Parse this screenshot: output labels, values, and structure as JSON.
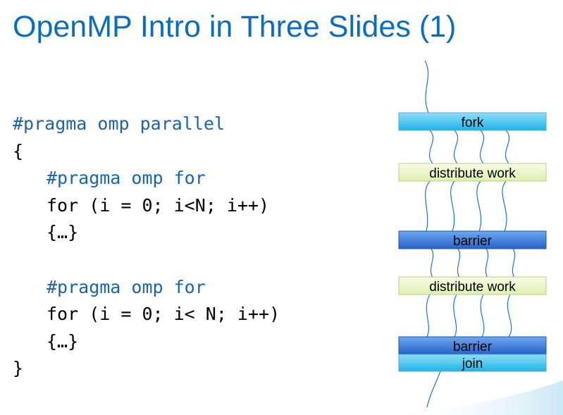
{
  "slide": {
    "title": "OpenMP Intro in Three Slides (1)"
  },
  "code": {
    "line1": "#pragma omp parallel",
    "line2": "{",
    "line3": "#pragma omp for",
    "line4": "for (i = 0; i<N; i++)",
    "line5": "{…}",
    "line6": "#pragma omp for",
    "line7": "for (i = 0; i< N; i++)",
    "line8": "{…}",
    "line9": "}"
  },
  "diagram": {
    "fork_label": "fork",
    "distribute1_label": "distribute work",
    "barrier1_label": "barrier",
    "distribute2_label": "distribute work",
    "barrier2_label": "barrier",
    "join_label": "join",
    "colors": {
      "fork_join": "#29bde8",
      "distribute": "#e9f5c2",
      "barrier": "#2f73d6",
      "thread_line": "#1d78c2",
      "title": "#0a6ec0",
      "pragma_text": "#1a64b4"
    }
  }
}
